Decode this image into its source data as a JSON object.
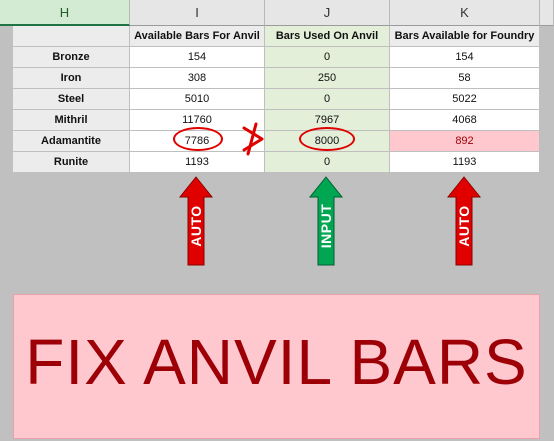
{
  "columns": [
    {
      "letter": "H",
      "selected": true
    },
    {
      "letter": "I",
      "selected": false
    },
    {
      "letter": "J",
      "selected": false
    },
    {
      "letter": "K",
      "selected": false
    }
  ],
  "headers": {
    "label": "",
    "available": "Available Bars For Anvil",
    "used": "Bars Used On Anvil",
    "foundry": "Bars Available for Foundry"
  },
  "rows": [
    {
      "label": "Bronze",
      "available": "154",
      "used": "0",
      "foundry": "154"
    },
    {
      "label": "Iron",
      "available": "308",
      "used": "250",
      "foundry": "58"
    },
    {
      "label": "Steel",
      "available": "5010",
      "used": "0",
      "foundry": "5022"
    },
    {
      "label": "Mithril",
      "available": "11760",
      "used": "7967",
      "foundry": "4068"
    },
    {
      "label": "Adamantite",
      "available": "7786",
      "used": "8000",
      "foundry": "892"
    },
    {
      "label": "Runite",
      "available": "1193",
      "used": "0",
      "foundry": "1193"
    }
  ],
  "annotations": {
    "arrow_available": "AUTO",
    "arrow_used": "INPUT",
    "arrow_foundry": "AUTO",
    "not_greater_symbol": ">"
  },
  "banner": {
    "text": "FIX ANVIL BARS"
  },
  "colors": {
    "selected_header": "#217346",
    "input_column": "#e3efd9",
    "error_fill": "#ffc7ce",
    "error_text": "#9c0006",
    "auto_arrow": "#e00000",
    "input_arrow": "#00a651"
  }
}
